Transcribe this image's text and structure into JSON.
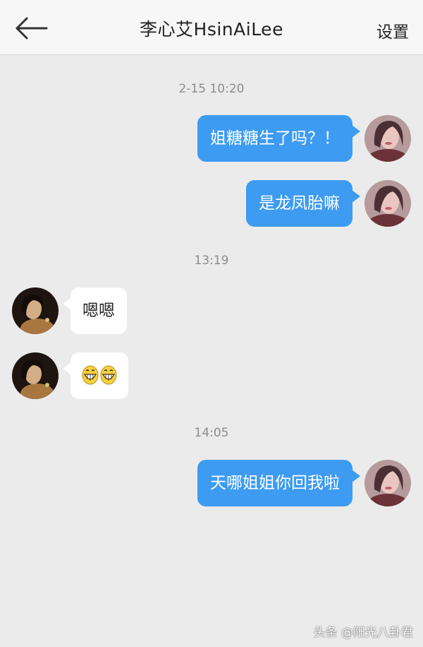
{
  "header": {
    "title": "李心艾HsinAiLee",
    "settings_label": "设置",
    "back_icon": "arrow-left-icon"
  },
  "messages": {
    "time_1": "2-15 10:20",
    "msg_1": "姐糖糖生了吗？！",
    "msg_2": "是龙凤胎嘛",
    "time_2": "13:19",
    "msg_3": "嗯嗯",
    "msg_4_emojis": [
      "grinning-face-icon",
      "grinning-face-icon"
    ],
    "time_3": "14:05",
    "msg_5": "天哪姐姐你回我啦"
  },
  "watermark": "头条 @阳光八卦君",
  "colors": {
    "background": "#ebebeb",
    "header_background": "#f7f7f7",
    "outgoing_bubble": "#3d9bf2",
    "incoming_bubble": "#ffffff",
    "timestamp": "#8c8c8c"
  }
}
